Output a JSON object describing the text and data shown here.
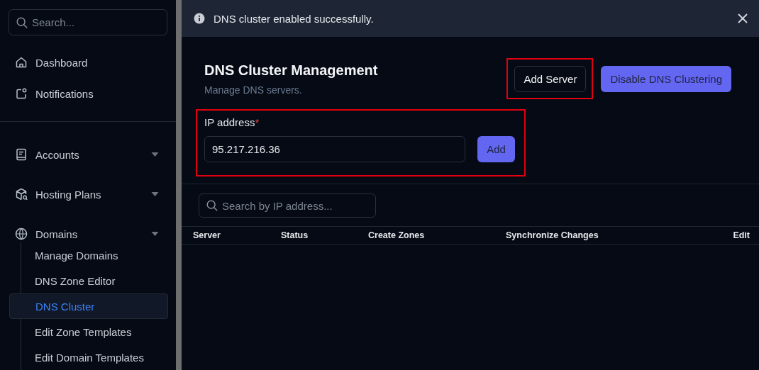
{
  "sidebar": {
    "search": {
      "placeholder": "Search..."
    },
    "groups": [
      {
        "items": [
          {
            "label": "Dashboard",
            "dropdown": false
          },
          {
            "label": "Notifications",
            "dropdown": false
          }
        ]
      },
      {
        "items": [
          {
            "label": "Accounts",
            "dropdown": true
          },
          {
            "label": "Hosting Plans",
            "dropdown": true
          },
          {
            "label": "Domains",
            "dropdown": true,
            "children": [
              {
                "label": "Manage Domains",
                "selected": false
              },
              {
                "label": "DNS Zone Editor",
                "selected": false
              },
              {
                "label": "DNS Cluster",
                "selected": true
              },
              {
                "label": "Edit Zone Templates",
                "selected": false
              },
              {
                "label": "Edit Domain Templates",
                "selected": false
              }
            ]
          }
        ]
      }
    ]
  },
  "toast": {
    "message": "DNS cluster enabled successfully."
  },
  "header": {
    "title": "DNS Cluster Management",
    "subtitle": "Manage DNS servers.",
    "buttons": [
      {
        "label": "Add Server",
        "kind": "outline",
        "highlighted": true
      },
      {
        "label": "Disable DNS Clustering",
        "kind": "primary",
        "highlighted": false
      }
    ]
  },
  "form": {
    "label": "IP address",
    "required_mark": "*",
    "value": "95.217.216.36",
    "button": "Add",
    "highlighted": true
  },
  "table": {
    "search": {
      "placeholder": "Search by IP address..."
    },
    "columns": [
      "Server",
      "Status",
      "Create Zones",
      "Synchronize Changes",
      "Edit"
    ]
  }
}
